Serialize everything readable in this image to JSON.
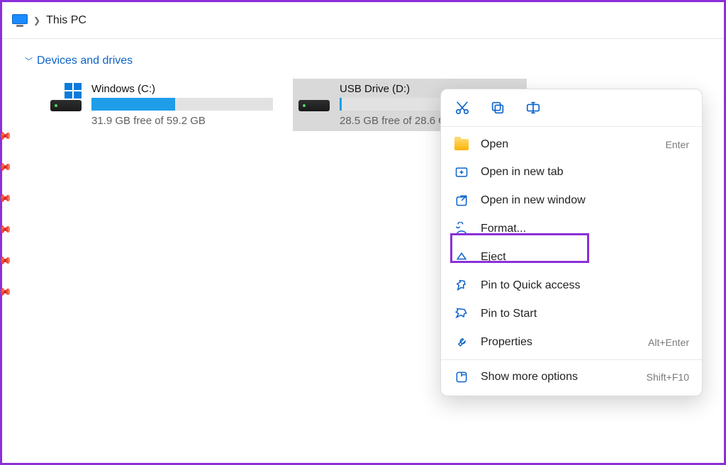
{
  "breadcrumb": {
    "title": "This PC"
  },
  "section": {
    "title": "Devices and drives"
  },
  "drives": [
    {
      "name": "Windows (C:)",
      "stats": "31.9 GB free of 59.2 GB",
      "fill_pct": 46
    },
    {
      "name": "USB Drive (D:)",
      "stats": "28.5 GB free of 28.6 GB",
      "fill_pct": 1
    }
  ],
  "context_menu": {
    "top_icons": [
      "cut-icon",
      "copy-icon",
      "rename-icon"
    ],
    "items": [
      {
        "label": "Open",
        "shortcut": "Enter",
        "icon": "folder-icon"
      },
      {
        "label": "Open in new tab",
        "shortcut": "",
        "icon": "new-tab-icon"
      },
      {
        "label": "Open in new window",
        "shortcut": "",
        "icon": "new-window-icon"
      },
      {
        "label": "Format...",
        "shortcut": "",
        "icon": "format-icon"
      },
      {
        "label": "Eject",
        "shortcut": "",
        "icon": "eject-icon"
      },
      {
        "label": "Pin to Quick access",
        "shortcut": "",
        "icon": "pin-icon"
      },
      {
        "label": "Pin to Start",
        "shortcut": "",
        "icon": "pin-icon"
      },
      {
        "label": "Properties",
        "shortcut": "Alt+Enter",
        "icon": "wrench-icon"
      }
    ],
    "more": {
      "label": "Show more options",
      "shortcut": "Shift+F10",
      "icon": "options-icon"
    }
  }
}
